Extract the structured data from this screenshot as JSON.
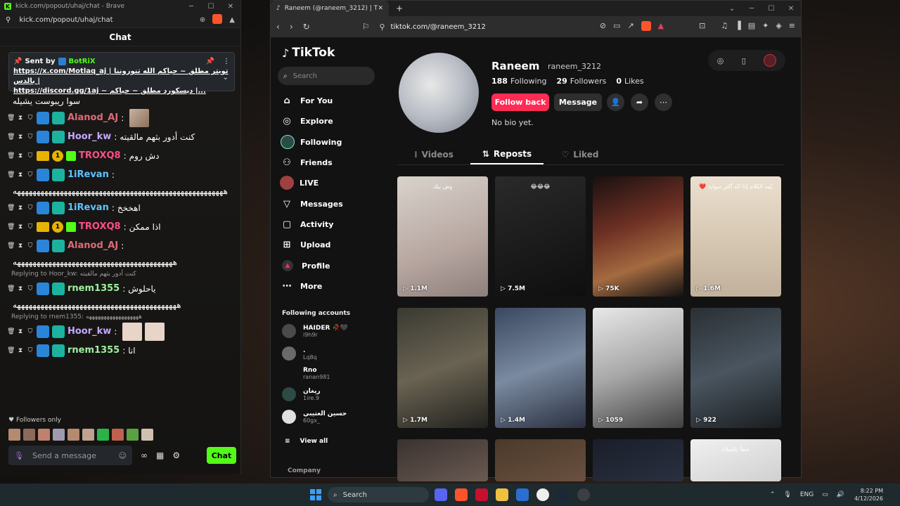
{
  "kick": {
    "title": "kick.com/popout/uhaj/chat - Brave",
    "url": "kick.com/popout/uhaj/chat",
    "header": "Chat",
    "pinned": {
      "sent_by": "Sent by",
      "bot_name": "BotRiX",
      "line1": "https://x.com/Motlaq_aj | تويتر مطلق ~ حياكم الله تنوروننا بالدس |",
      "line2": "https://discord.gg/1aj ~ ديسكورد مطلق ~ حياكم |..."
    },
    "messages": [
      {
        "type": "text",
        "text": "سوا ريبوست يشيله"
      },
      {
        "user": "Alanod_AJ",
        "color": "#e06a78",
        "text": ""
      },
      {
        "user": "Hoor_kw",
        "color": "#c6a7ff",
        "text": "كنت أدور بثهم مالقيته"
      },
      {
        "user": "TROXQ8",
        "color": "#ff4d88",
        "text": "دش روم",
        "num": "1"
      },
      {
        "user": "1iRevan",
        "color": "#5ec3ff",
        "text": ""
      },
      {
        "type": "wrap",
        "text": "ههههههههههههههههههههههههههههههههههههههههههههههههههههههه"
      },
      {
        "user": "1iRevan",
        "color": "#5ec3ff",
        "text": "اهخخخ"
      },
      {
        "user": "TROXQ8",
        "color": "#ff4d88",
        "text": "اذا ممكن",
        "num": "1"
      },
      {
        "user": "Alanod_AJ",
        "color": "#e06a78",
        "text": ""
      },
      {
        "type": "wrap",
        "text": "هههههههههههههههههههههههههههههههههههههههههه"
      },
      {
        "type": "reply",
        "text": "Replying to Hoor_kw: كنت أدور بثهم مالقيته"
      },
      {
        "user": "rnem1355",
        "color": "#9ff0a0",
        "text": "ياحلوش"
      },
      {
        "type": "wrap",
        "text": "ههههههههههههههههههههههههههههههههههههههههههه"
      },
      {
        "type": "reply",
        "text": "Replying to rnem1355: ههههههههههههههههههه"
      },
      {
        "user": "Hoor_kw",
        "color": "#c6a7ff",
        "text": ""
      },
      {
        "user": "rnem1355",
        "color": "#9ff0a0",
        "text": "انا"
      }
    ],
    "followers_only": "Followers only",
    "send_placeholder": "Send a message",
    "chat_button": "Chat"
  },
  "brave": {
    "tab_title": "Raneem (@raneem_3212) | TikTok",
    "url": "tiktok.com/@raneem_3212"
  },
  "tiktok": {
    "logo": "TikTok",
    "search_placeholder": "Search",
    "nav": [
      "For You",
      "Explore",
      "Following",
      "Friends",
      "LIVE",
      "Messages",
      "Activity",
      "Upload",
      "Profile",
      "More"
    ],
    "following_accounts_title": "Following accounts",
    "following_accounts": [
      {
        "name": "HAIDER 🥀🖤",
        "handle": "i9h9r"
      },
      {
        "name": ".",
        "handle": "Lq8q"
      },
      {
        "name": "Rno",
        "handle": "ranan981"
      },
      {
        "name": "ريغان",
        "handle": "1ire.9"
      },
      {
        "name": "حسين العتيبي",
        "handle": "60gx_"
      }
    ],
    "view_all": "View all",
    "company": "Company",
    "profile": {
      "name": "Raneem",
      "handle": "raneem_3212",
      "following": "188",
      "following_label": "Following",
      "followers": "29",
      "followers_label": "Followers",
      "likes": "0",
      "likes_label": "Likes",
      "follow_back": "Follow back",
      "message": "Message",
      "bio": "No bio yet."
    },
    "tabs": [
      "Videos",
      "Reposts",
      "Liked"
    ],
    "videos": [
      {
        "views": "1.1M",
        "bg": "linear-gradient(160deg,#d9d3cc,#b7a6a0 60%,#8d7f7c)",
        "caption": "وش بيك"
      },
      {
        "views": "7.5M",
        "bg": "linear-gradient(160deg,#2a2a2a,#0e0e0e)",
        "caption": "😂😂😂"
      },
      {
        "views": "75K",
        "bg": "linear-gradient(160deg,#1a1010,#6e3024 40%,#a46a40 70%,#121212)",
        "caption": ""
      },
      {
        "views": "1.6M",
        "bg": "linear-gradient(180deg,#eadfd0,#d8c9b4 50%,#c1b19c)",
        "caption": "يُمه الكلام إذا انّه أكثر سوايد ❤️"
      },
      {
        "views": "1.7M",
        "bg": "linear-gradient(160deg,#3a3a32,#6a6352 50%,#22221e)",
        "caption": ""
      },
      {
        "views": "1.4M",
        "bg": "linear-gradient(160deg,#3a4860,#7a8aa0 50%,#2a3040)",
        "caption": ""
      },
      {
        "views": "1059",
        "bg": "linear-gradient(160deg,#e8e8e8,#a8a8a8 50%,#404040)",
        "caption": ""
      },
      {
        "views": "922",
        "bg": "linear-gradient(160deg,#2a3034,#4a5560 50%,#1a1e20)",
        "caption": ""
      },
      {
        "views": "",
        "bg": "linear-gradient(160deg,#3a3230,#6a5a52)",
        "caption": ""
      },
      {
        "views": "",
        "bg": "linear-gradient(160deg,#4a3a2a,#6a5040)",
        "caption": ""
      },
      {
        "views": "",
        "bg": "linear-gradient(160deg,#1a1e2a,#2a3040)",
        "caption": ""
      },
      {
        "views": "",
        "bg": "linear-gradient(160deg,#f0f0f0,#d0d0d0)",
        "caption": "خطأ بالصلاة"
      }
    ]
  },
  "taskbar": {
    "search": "Search",
    "lang": "ENG",
    "time": "8:22 PM",
    "date": "4/12/2026"
  }
}
